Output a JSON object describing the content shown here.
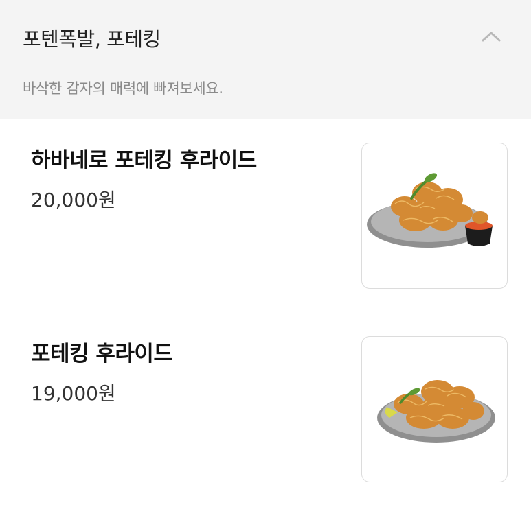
{
  "category": {
    "title": "포텐폭발, 포테킹",
    "description": "바삭한 감자의 매력에 빠져보세요.",
    "collapse_icon": "chevron-up-icon"
  },
  "menu_items": [
    {
      "name": "하바네로 포테킹 후라이드",
      "price": "20,000원",
      "image": "fried-chicken-with-sauce-image"
    },
    {
      "name": "포테킹 후라이드",
      "price": "19,000원",
      "image": "fried-chicken-image"
    }
  ],
  "colors": {
    "header_bg": "#f4f4f4",
    "chicken": "#d9923a",
    "plate": "#9a9a9a"
  }
}
